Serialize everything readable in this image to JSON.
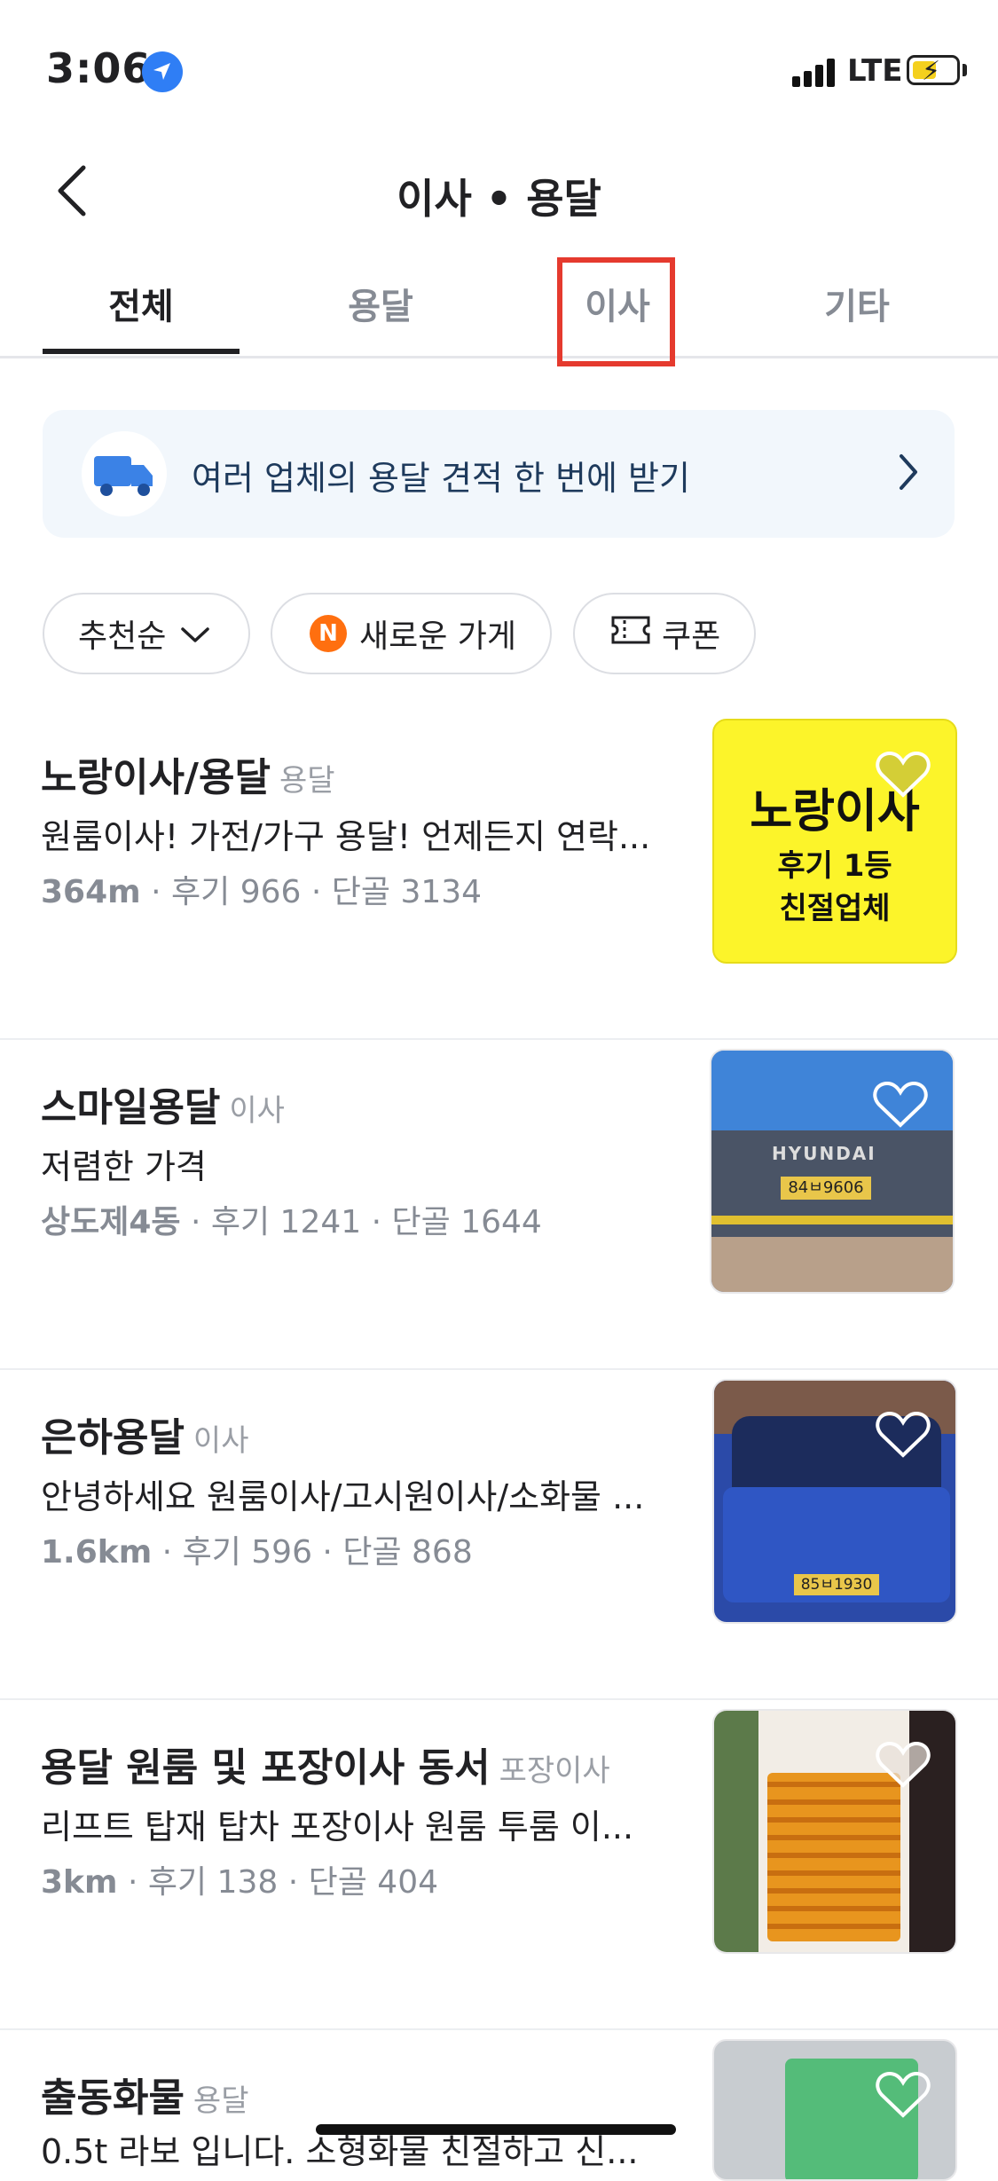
{
  "status": {
    "time": "3:06",
    "network": "LTE"
  },
  "header": {
    "title": "이사 • 용달"
  },
  "tabs": [
    {
      "label": "전체",
      "active": true
    },
    {
      "label": "용달",
      "active": false
    },
    {
      "label": "이사",
      "active": false,
      "highlighted": true
    },
    {
      "label": "기타",
      "active": false
    }
  ],
  "banner": {
    "text": "여러 업체의 용달 견적 한 번에 받기"
  },
  "filters": {
    "sort_label": "추천순",
    "new_store_badge": "N",
    "new_store_label": "새로운 가게",
    "coupon_label": "쿠폰"
  },
  "listings": [
    {
      "name": "노랑이사/용달",
      "category": "용달",
      "description": "원룸이사! 가전/가구 용달! 언제든지 연락...",
      "distance": "364m",
      "reviews": "후기 966",
      "regulars": "단골 3134",
      "thumb_text": {
        "line1": "노랑이사",
        "line2": "후기 1등",
        "line3": "친절업체"
      }
    },
    {
      "name": "스마일용달",
      "category": "이사",
      "description": "저렴한 가격",
      "distance": "상도제4동",
      "reviews": "후기 1241",
      "regulars": "단골 1644",
      "thumb_text": {
        "brand": "HYUNDAI",
        "plate": "84ㅂ9606"
      }
    },
    {
      "name": "은하용달",
      "category": "이사",
      "description": "안녕하세요 원룸이사/고시원이사/소화물 ...",
      "distance": "1.6km",
      "reviews": "후기 596",
      "regulars": "단골 868",
      "thumb_text": {
        "plate": "85ㅂ1930"
      }
    },
    {
      "name": "용달 원룸 및 포장이사 동서",
      "category": "포장이사",
      "description": "리프트 탑재 탑차 포장이사 원룸 투룸 이...",
      "distance": "3km",
      "reviews": "후기 138",
      "regulars": "단골 404"
    },
    {
      "name": "출동화물",
      "category": "용달",
      "description": "0.5t 라보 입니다. 소형화물 친절하고 신...",
      "distance": "",
      "reviews": "",
      "regulars": ""
    }
  ],
  "colors": {
    "accent": "#ff6f0f",
    "highlight": "#e53a2e",
    "banner_bg": "#f2f7fc",
    "thumb_yellow": "#fcf42a"
  }
}
